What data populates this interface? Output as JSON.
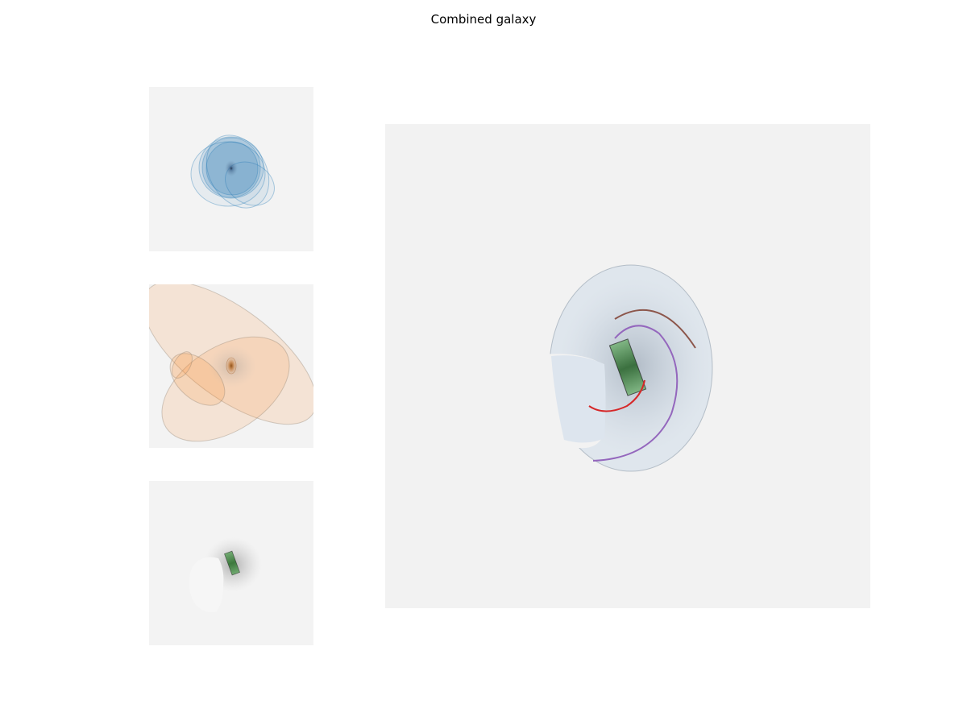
{
  "figure": {
    "title": "Combined galaxy"
  },
  "panels": [
    {
      "name": "disk-component",
      "accent": "#1f77b4"
    },
    {
      "name": "bulge-component",
      "accent": "#ff7f0e"
    },
    {
      "name": "bar-component",
      "accent": "#2ca02c"
    },
    {
      "name": "combined-galaxy",
      "accent": "#1f77b4"
    }
  ],
  "colors": {
    "background_noise": "#f2f2f2",
    "disk": "#1f77b4",
    "bulge": "#ff7f0e",
    "bar": "#2ca02c",
    "spiral_arm_red": "#d62728",
    "spiral_arm_purple": "#9467bd",
    "spiral_arm_brown": "#8c564b"
  }
}
